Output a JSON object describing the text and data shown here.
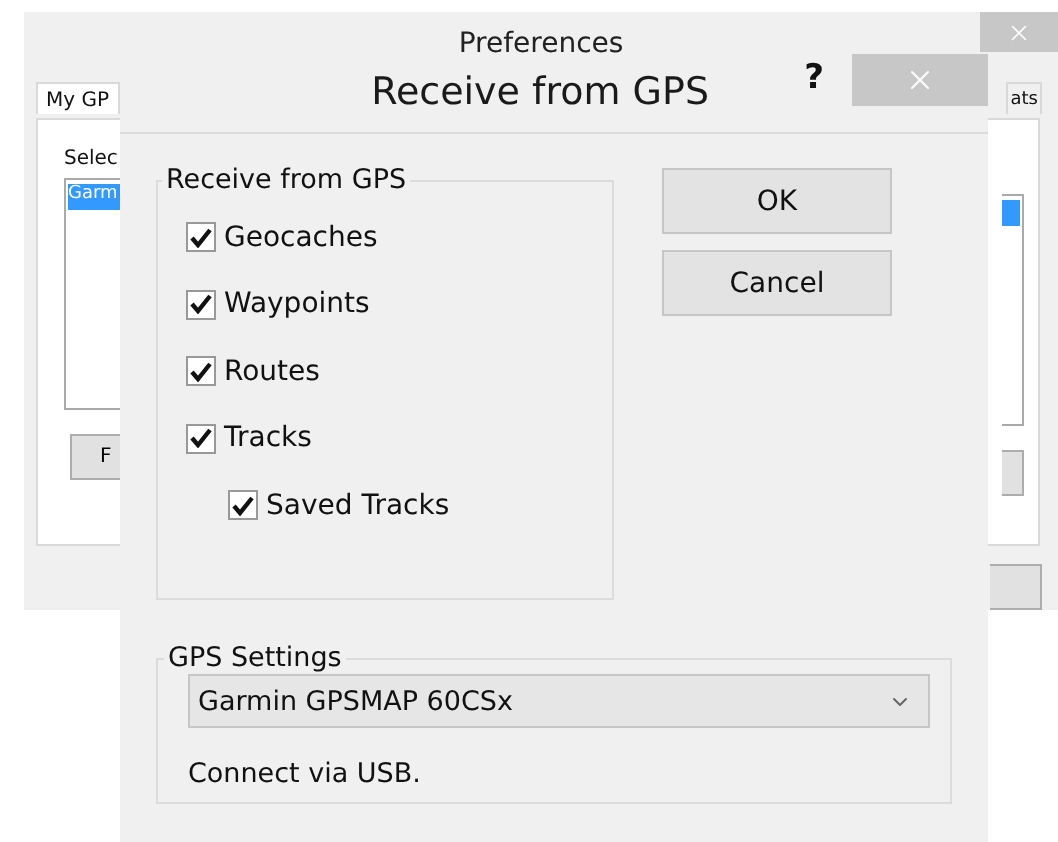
{
  "back_window": {
    "title": "Preferences",
    "tabs": [
      {
        "label": "My GP",
        "selected": true
      },
      {
        "label": "ats",
        "selected": false
      }
    ],
    "select_label": "Selec",
    "devices": [
      {
        "label": "Garm",
        "selected": true
      }
    ],
    "button": "F"
  },
  "dialog": {
    "title": "Receive from GPS",
    "help": "?",
    "receive_group": {
      "title": "Receive from GPS",
      "items": [
        {
          "label": "Geocaches",
          "checked": true
        },
        {
          "label": "Waypoints",
          "checked": true
        },
        {
          "label": "Routes",
          "checked": true
        },
        {
          "label": "Tracks",
          "checked": true,
          "children": [
            {
              "label": "Saved Tracks",
              "checked": true
            }
          ]
        }
      ]
    },
    "buttons": [
      "OK",
      "Cancel"
    ],
    "gps_settings": {
      "title": "GPS Settings",
      "device": "Garmin GPSMAP 60CSx",
      "note": "Connect via USB."
    }
  }
}
